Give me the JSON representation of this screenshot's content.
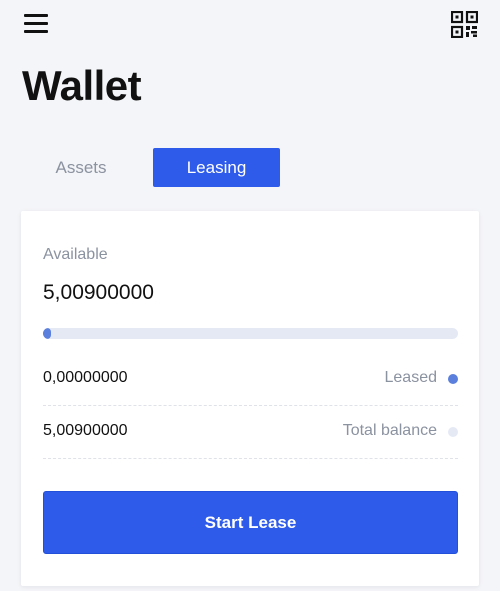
{
  "header": {
    "menu_icon": "hamburger-menu-icon",
    "qr_icon": "qr-code-icon"
  },
  "page": {
    "title": "Wallet"
  },
  "tabs": [
    {
      "label": "Assets",
      "active": false
    },
    {
      "label": "Leasing",
      "active": true
    }
  ],
  "leasing": {
    "available_label": "Available",
    "available_value": "5,00900000",
    "leased_fraction": 0.02,
    "rows": [
      {
        "value": "0,00000000",
        "label": "Leased",
        "dot_color": "#5b7fdc"
      },
      {
        "value": "5,00900000",
        "label": "Total balance",
        "dot_color": "#e4e9f4"
      }
    ],
    "start_button_label": "Start Lease"
  },
  "colors": {
    "accent": "#2f5bea",
    "muted_text": "#8b92a0",
    "background": "#f4f5f8",
    "progress_fill": "#5b7fdc",
    "progress_track": "#e4e9f4"
  }
}
